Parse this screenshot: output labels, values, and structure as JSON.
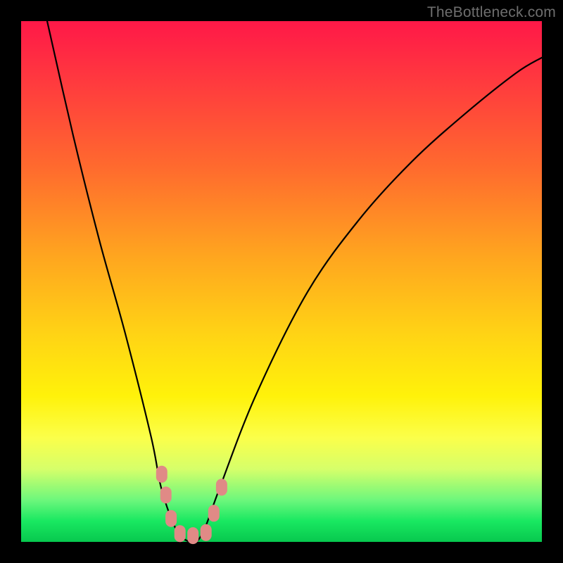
{
  "watermark": "TheBottleneck.com",
  "chart_data": {
    "type": "line",
    "title": "",
    "xlabel": "",
    "ylabel": "",
    "xlim": [
      0,
      100
    ],
    "ylim": [
      0,
      100
    ],
    "series": [
      {
        "name": "bottleneck-curve",
        "x": [
          5,
          10,
          15,
          20,
          25,
          27,
          30,
          33,
          35,
          38,
          45,
          55,
          65,
          75,
          85,
          95,
          100
        ],
        "values": [
          100,
          78,
          58,
          40,
          20,
          10,
          2,
          0,
          2,
          10,
          28,
          48,
          62,
          73,
          82,
          90,
          93
        ]
      }
    ],
    "annotations": [
      {
        "name": "marker-left-upper",
        "x": 27.0,
        "y": 13.0
      },
      {
        "name": "marker-left-mid",
        "x": 27.8,
        "y": 9.0
      },
      {
        "name": "marker-left-low",
        "x": 28.8,
        "y": 4.5
      },
      {
        "name": "marker-bottom-a",
        "x": 30.5,
        "y": 1.6
      },
      {
        "name": "marker-bottom-b",
        "x": 33.0,
        "y": 1.2
      },
      {
        "name": "marker-bottom-c",
        "x": 35.5,
        "y": 1.8
      },
      {
        "name": "marker-right-low",
        "x": 37.0,
        "y": 5.5
      },
      {
        "name": "marker-right-upper",
        "x": 38.5,
        "y": 10.5
      }
    ],
    "marker_color": "#e08a86",
    "curve_color": "#000000"
  }
}
